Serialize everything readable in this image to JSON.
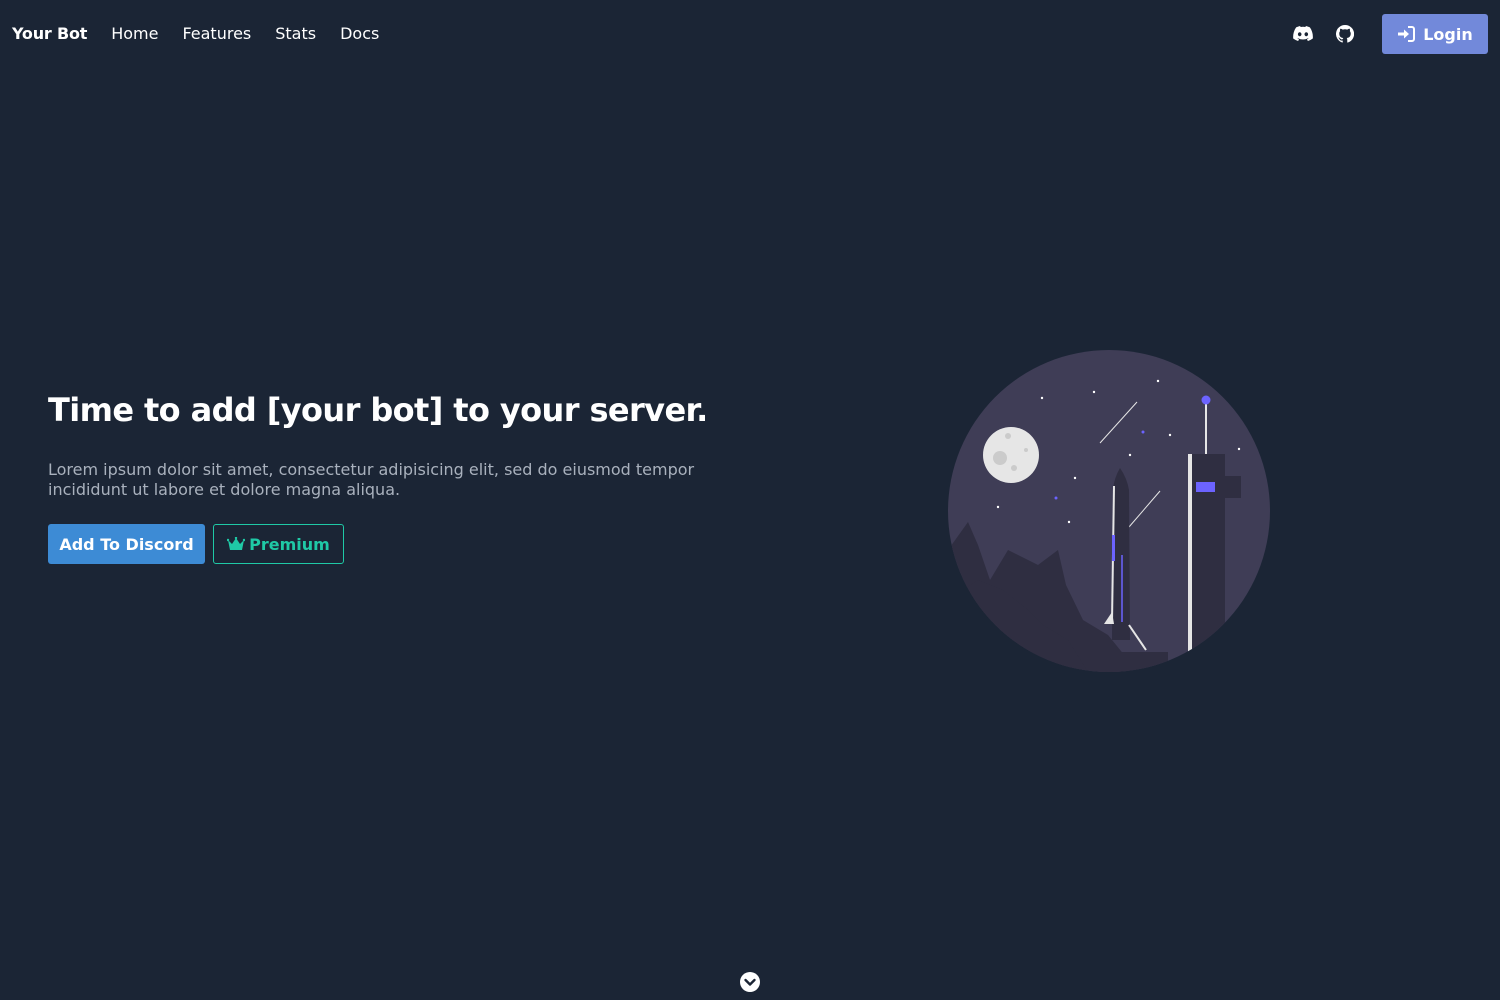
{
  "navbar": {
    "brand": "Your Bot",
    "links": [
      {
        "label": "Home"
      },
      {
        "label": "Features"
      },
      {
        "label": "Stats"
      },
      {
        "label": "Docs"
      }
    ],
    "icons": {
      "discord": "discord-icon",
      "github": "github-icon",
      "login": "sign-in-icon"
    },
    "login_label": "Login"
  },
  "hero": {
    "title": "Time to add [your bot] to your server.",
    "subtitle": "Lorem ipsum dolor sit amet, consectetur adipisicing elit, sed do eiusmod tempor incididunt ut labore et dolore magna aliqua.",
    "primary_button": "Add To Discord",
    "secondary_button": "Premium",
    "secondary_icon": "crown-icon",
    "illustration": "rocket-launch-illustration"
  },
  "scroll_icon": "chevron-down-circle-icon",
  "colors": {
    "background": "#1b2535",
    "login": "#7289da",
    "discord_button": "#3d8bd5",
    "premium_accent": "#1fc9a6",
    "illustration_circle": "#3f3d56",
    "illustration_accent": "#6c63ff"
  }
}
